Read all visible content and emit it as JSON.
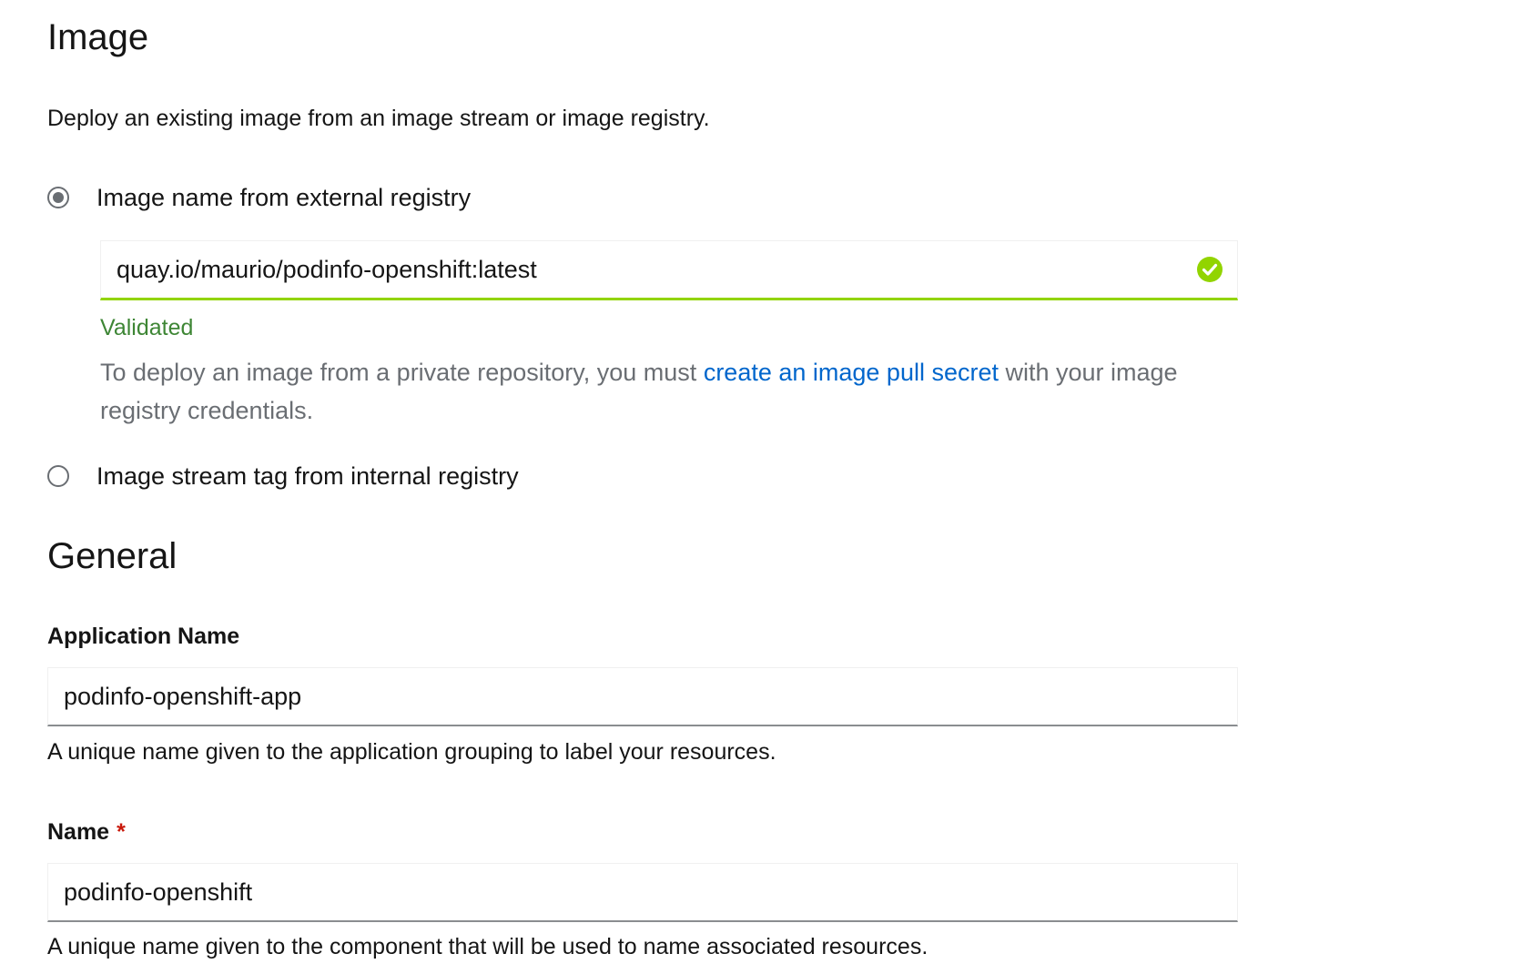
{
  "image_section": {
    "title": "Image",
    "description": "Deploy an existing image from an image stream or image registry.",
    "options": [
      {
        "label": "Image name from external registry",
        "selected": true
      },
      {
        "label": "Image stream tag from internal registry",
        "selected": false
      }
    ],
    "image_name_value": "quay.io/maurio/podinfo-openshift:latest",
    "validation_text": "Validated",
    "validation_icon": "check-circle-icon",
    "private_note": {
      "prefix": "To deploy an image from a private repository, you must ",
      "link": "create an image pull secret",
      "suffix": " with your image registry credentials."
    }
  },
  "general_section": {
    "title": "General",
    "application_name": {
      "label": "Application Name",
      "value": "podinfo-openshift-app",
      "helper": "A unique name given to the application grouping to label your resources."
    },
    "name": {
      "label": "Name",
      "required_marker": "*",
      "value": "podinfo-openshift",
      "helper": "A unique name given to the component that will be used to name associated resources."
    }
  },
  "colors": {
    "success": "#3e8635",
    "valid_border": "#92d400",
    "link": "#0066cc",
    "required": "#c9190b"
  }
}
